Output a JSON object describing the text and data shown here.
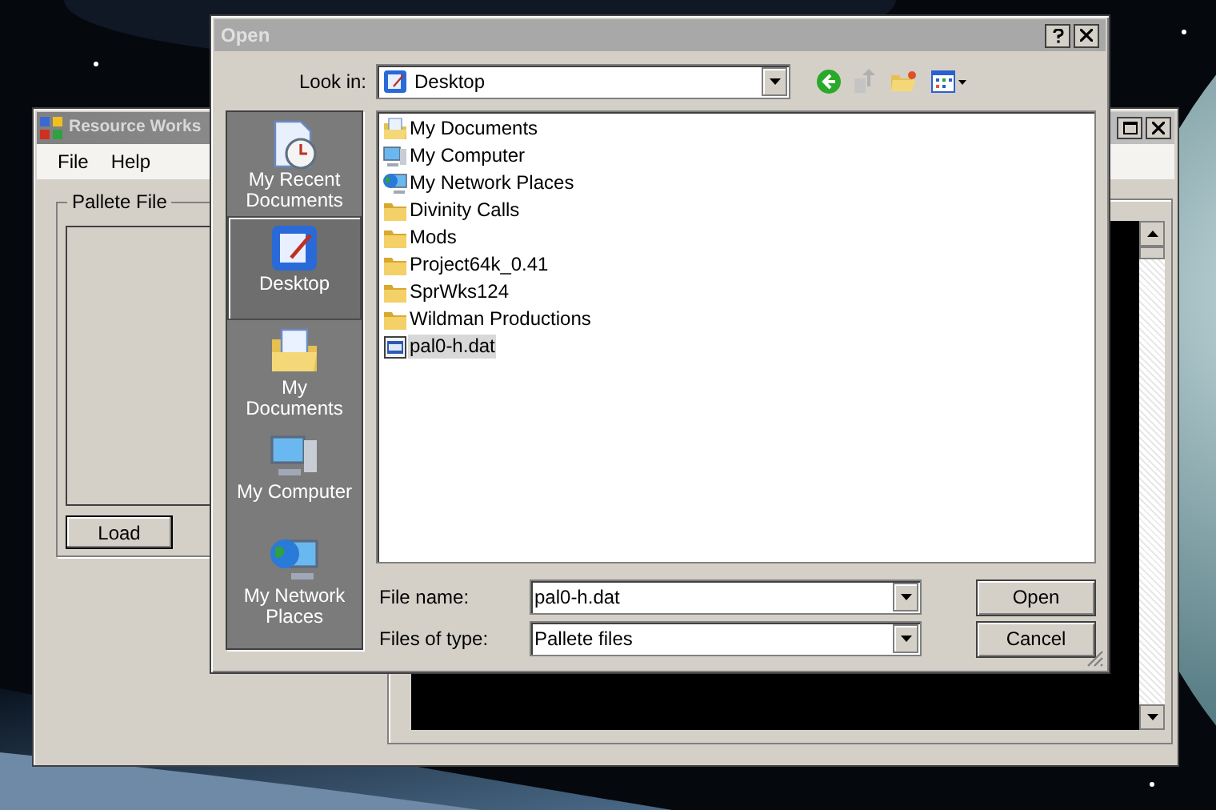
{
  "back_window": {
    "title": "Resource Works",
    "menu": [
      "File",
      "Help"
    ],
    "group_title": "Pallete File",
    "load_button": "Load"
  },
  "dialog": {
    "title": "Open",
    "look_in_label": "Look in:",
    "look_in_value": "Desktop",
    "places": [
      {
        "label": "My Recent Documents",
        "kind": "recent",
        "selected": false
      },
      {
        "label": "Desktop",
        "kind": "desktop",
        "selected": true
      },
      {
        "label": "My Documents",
        "kind": "mydocs",
        "selected": false
      },
      {
        "label": "My Computer",
        "kind": "computer",
        "selected": false
      },
      {
        "label": "My Network Places",
        "kind": "network",
        "selected": false
      }
    ],
    "files": [
      {
        "name": "My Documents",
        "kind": "mydocs",
        "selected": false
      },
      {
        "name": "My Computer",
        "kind": "computer",
        "selected": false
      },
      {
        "name": "My Network Places",
        "kind": "network",
        "selected": false
      },
      {
        "name": "Divinity Calls",
        "kind": "folder",
        "selected": false
      },
      {
        "name": "Mods",
        "kind": "folder",
        "selected": false
      },
      {
        "name": "Project64k_0.41",
        "kind": "folder",
        "selected": false
      },
      {
        "name": "SprWks124",
        "kind": "folder",
        "selected": false
      },
      {
        "name": "Wildman Productions",
        "kind": "folder",
        "selected": false
      },
      {
        "name": "pal0-h.dat",
        "kind": "file",
        "selected": true
      }
    ],
    "file_name_label": "File name:",
    "file_name": "pal0-h.dat",
    "file_type_label": "Files of type:",
    "file_type": "Pallete files",
    "buttons": [
      "Open",
      "Cancel"
    ]
  }
}
